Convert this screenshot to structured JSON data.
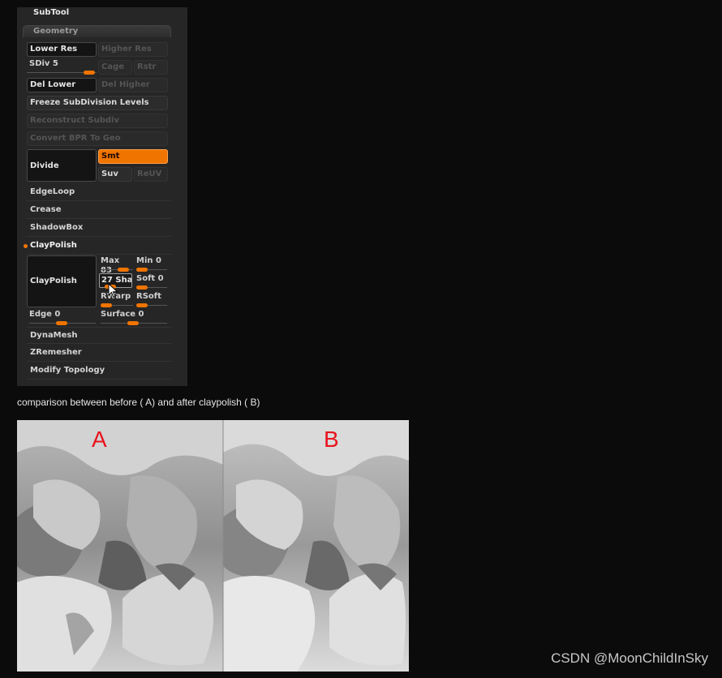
{
  "panel": {
    "title": "SubTool",
    "group": "Geometry",
    "buttons": {
      "lower_res": "Lower Res",
      "higher_res": "Higher Res",
      "sdiv_label": "SDiv 5",
      "cage": "Cage",
      "rstr": "Rstr",
      "del_lower": "Del Lower",
      "del_higher": "Del Higher",
      "freeze": "Freeze SubDivision Levels",
      "reconstruct": "Reconstruct Subdiv",
      "convert_bpr": "Convert BPR To Geo",
      "divide": "Divide",
      "smt": "Smt",
      "suv": "Suv",
      "reuv": "ReUV"
    },
    "rows": {
      "edgeloop": "EdgeLoop",
      "crease": "Crease",
      "shadowbox": "ShadowBox",
      "claypolish": "ClayPolish",
      "dynamesh": "DynaMesh",
      "zremesher": "ZRemesher",
      "modify_topology": "Modify Topology"
    },
    "claypolish": {
      "button": "ClayPolish",
      "max": "Max 83",
      "min": "Min 0",
      "sharpness": "27 Sha",
      "soft": "Soft 0",
      "rwarp": "RWarp",
      "rsoft": "RSoft",
      "edge": "Edge 0",
      "surface": "Surface 0"
    },
    "accent": "#f07400"
  },
  "caption": "comparison between before ( A) and after claypolish ( B)",
  "image": {
    "label_a": "A",
    "label_b": "B"
  },
  "watermark": "CSDN @MoonChildInSky"
}
